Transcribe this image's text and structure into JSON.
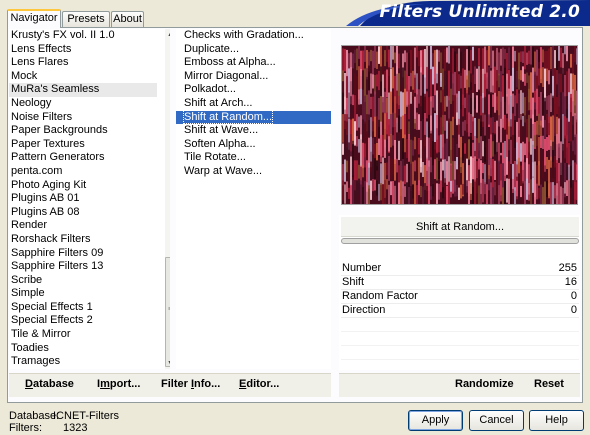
{
  "tabs": [
    {
      "label": "Navigator",
      "active": true
    },
    {
      "label": "Presets",
      "active": false
    },
    {
      "label": "About",
      "active": false
    }
  ],
  "title": "Filters Unlimited 2.0",
  "categories": [
    "Krusty's FX vol. II 1.0",
    "Lens Effects",
    "Lens Flares",
    "Mock",
    "MuRa's Seamless",
    "Neology",
    "Noise Filters",
    "Paper Backgrounds",
    "Paper Textures",
    "Pattern Generators",
    "penta.com",
    "Photo Aging Kit",
    "Plugins AB 01",
    "Plugins AB 08",
    "Render",
    "Rorshack Filters",
    "Sapphire Filters 09",
    "Sapphire Filters 13",
    "Scribe",
    "Simple",
    "Special Effects 1",
    "Special Effects 2",
    "Tile & Mirror",
    "Toadies",
    "Tramages"
  ],
  "selected_category": "MuRa's Seamless",
  "filters": [
    "Checks with Gradation...",
    "Duplicate...",
    "Emboss at Alpha...",
    "Mirror Diagonal...",
    "Polkadot...",
    "Shift at Arch...",
    "Shift at Random...",
    "Shift at Wave...",
    "Soften Alpha...",
    "Tile Rotate...",
    "Warp at Wave..."
  ],
  "selected_filter": "Shift at Random...",
  "filter_button_label": "Shift at Random...",
  "params": [
    {
      "name": "Number",
      "value": "255"
    },
    {
      "name": "Shift",
      "value": "16"
    },
    {
      "name": "Random Factor",
      "value": "0"
    },
    {
      "name": "Direction",
      "value": "0"
    }
  ],
  "toolbar": {
    "database": {
      "mnemonic": "D",
      "rest": "atabase"
    },
    "import": {
      "pre": "I",
      "mnemonic": "m",
      "rest": "port..."
    },
    "filter_info": {
      "pre": "Filter ",
      "mnemonic": "I",
      "rest": "nfo..."
    },
    "editor": {
      "mnemonic": "E",
      "rest": "ditor..."
    },
    "randomize": "Randomize",
    "reset": "Reset"
  },
  "status": {
    "database_label": "Database:",
    "database_value": "ICNET-Filters",
    "filters_label": "Filters:",
    "filters_value": "1323"
  },
  "buttons": {
    "apply": "Apply",
    "cancel": "Cancel",
    "help": "Help"
  },
  "colors": {
    "banner": "#0b2a8c",
    "selection": "#316ac5",
    "tab_highlight": "#ffc73c"
  },
  "icons": {
    "scroll_up": "triangle-up",
    "scroll_down": "triangle-down",
    "scroll_grip": "grip-lines"
  }
}
